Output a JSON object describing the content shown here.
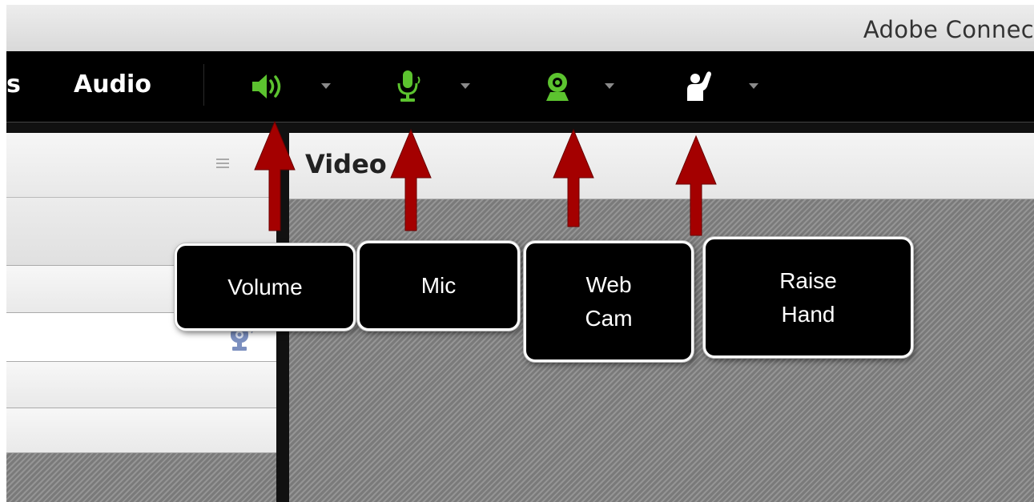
{
  "window": {
    "title": "Adobe Connec"
  },
  "menu": {
    "partial_item": "s",
    "audio_label": "Audio"
  },
  "toolbar": {
    "icons": [
      "speaker-icon",
      "microphone-icon",
      "webcam-icon",
      "raise-hand-icon"
    ],
    "accent_color": "#5cc32f"
  },
  "video_pod": {
    "title": "Video"
  },
  "callouts": {
    "volume": "Volume",
    "mic": "Mic",
    "webcam": "Web Cam",
    "raise_hand": "Raise Hand"
  }
}
